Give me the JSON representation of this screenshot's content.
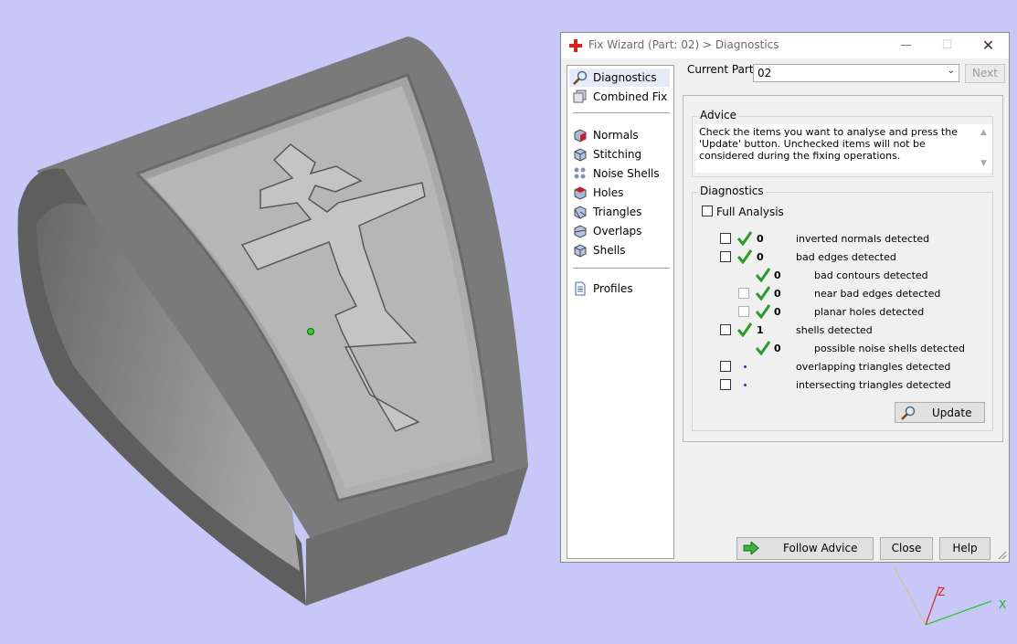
{
  "viewport": {
    "background": "#c8c8f8",
    "model": "ring-with-cross",
    "axes": {
      "z_label": "Z",
      "x_label": "X"
    }
  },
  "dialog": {
    "title": "Fix Wizard (Part: 02) > Diagnostics",
    "title_icon": "red-cross-icon",
    "nav": {
      "items": [
        {
          "label": "Diagnostics",
          "icon": "magnifier-icon",
          "selected": true
        },
        {
          "label": "Combined Fix",
          "icon": "combined-fix-icon"
        },
        {
          "label": "Normals",
          "icon": "normals-cube-icon"
        },
        {
          "label": "Stitching",
          "icon": "stitching-cube-icon"
        },
        {
          "label": "Noise Shells",
          "icon": "noise-shells-icon"
        },
        {
          "label": "Holes",
          "icon": "holes-cube-icon"
        },
        {
          "label": "Triangles",
          "icon": "triangles-cube-icon"
        },
        {
          "label": "Overlaps",
          "icon": "overlaps-cube-icon"
        },
        {
          "label": "Shells",
          "icon": "shells-cube-icon"
        },
        {
          "label": "Profiles",
          "icon": "document-icon"
        }
      ]
    },
    "current_part": {
      "label": "Current Part:",
      "value": "02"
    },
    "next_label": "Next",
    "advice": {
      "title": "Advice",
      "text": "Check the items you want to analyse and press the 'Update' button. Unchecked items will not be considered during the fixing operations."
    },
    "diagnostics": {
      "title": "Diagnostics",
      "full_analysis": "Full Analysis",
      "rows": [
        {
          "count": "0",
          "label": "inverted normals detected"
        },
        {
          "count": "0",
          "label": "bad edges detected"
        },
        {
          "count": "0",
          "label": "bad contours detected"
        },
        {
          "count": "0",
          "label": "near bad edges detected"
        },
        {
          "count": "0",
          "label": "planar holes detected"
        },
        {
          "count": "1",
          "label": "shells detected"
        },
        {
          "count": "0",
          "label": "possible noise shells detected"
        },
        {
          "count": "",
          "label": "overlapping triangles detected"
        },
        {
          "count": "",
          "label": "intersecting triangles detected"
        }
      ]
    },
    "buttons": {
      "update": "Update",
      "follow_advice": "Follow Advice",
      "close": "Close",
      "help": "Help"
    },
    "colors": {
      "check_green": "#2e9a2e",
      "accent_red": "#d8221c"
    }
  }
}
